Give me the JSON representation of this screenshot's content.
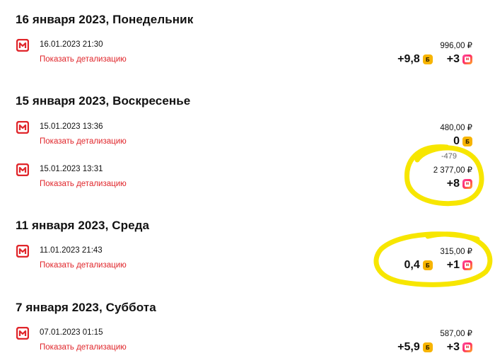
{
  "days": [
    {
      "heading": "16 января 2023, Понедельник"
    },
    {
      "heading": "15 января 2023, Воскресенье"
    },
    {
      "heading": "11 января 2023, Среда"
    },
    {
      "heading": "7 января 2023, Суббота"
    }
  ],
  "transactions": [
    {
      "datetime": "16.01.2023 21:30",
      "detail": "Показать детализацию",
      "amount": "996,00 ₽",
      "bonus": "+9,8",
      "coin_label": "Б",
      "miles": "+3"
    },
    {
      "datetime": "15.01.2023 13:36",
      "detail": "Показать детализацию",
      "amount": "480,00 ₽",
      "bonus": "0",
      "coin_label": "Б",
      "miles": ""
    },
    {
      "datetime": "15.01.2023 13:31",
      "detail": "Показать детализацию",
      "amount": "2 377,00 ₽",
      "bonus": "",
      "coin_label": "Б",
      "miles": "+8"
    },
    {
      "datetime": "11.01.2023 21:43",
      "detail": "Показать детализацию",
      "amount": "315,00 ₽",
      "bonus": "0,4",
      "coin_label": "Б",
      "miles": "+1"
    },
    {
      "datetime": "07.01.2023 01:15",
      "detail": "Показать детализацию",
      "amount": "587,00 ₽",
      "bonus": "+5,9",
      "coin_label": "Б",
      "miles": "+3"
    }
  ],
  "annotation": {
    "diff": "-479"
  },
  "icons": {
    "store_logo": "magnit-logo-icon",
    "bonus_coin": "bonus-coin-icon",
    "miles_badge": "magnit-badge-icon"
  },
  "colors": {
    "brand_red": "#e0262b",
    "coin_yellow": "#f7b400",
    "highlight_yellow": "#f7e600"
  }
}
